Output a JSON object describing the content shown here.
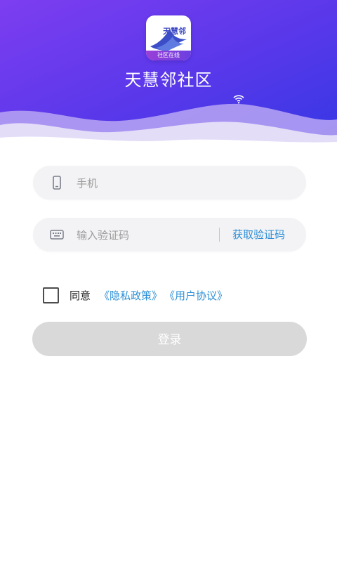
{
  "header": {
    "logo_text": "天慧邻",
    "logo_subtext": "社区在线",
    "app_name": "天慧邻社区"
  },
  "form": {
    "phone_placeholder": "手机",
    "phone_value": "",
    "code_placeholder": "输入验证码",
    "code_value": "",
    "get_code_label": "获取验证码",
    "agree_label": "同意",
    "privacy_link": "《隐私政策》",
    "terms_link": "《用户协议》",
    "agree_checked": false,
    "login_label": "登录"
  },
  "colors": {
    "header_gradient_start": "#7a3df0",
    "header_gradient_end": "#3a37e6",
    "link": "#2c8fd6",
    "login_button_disabled": "#d9d9d9"
  }
}
